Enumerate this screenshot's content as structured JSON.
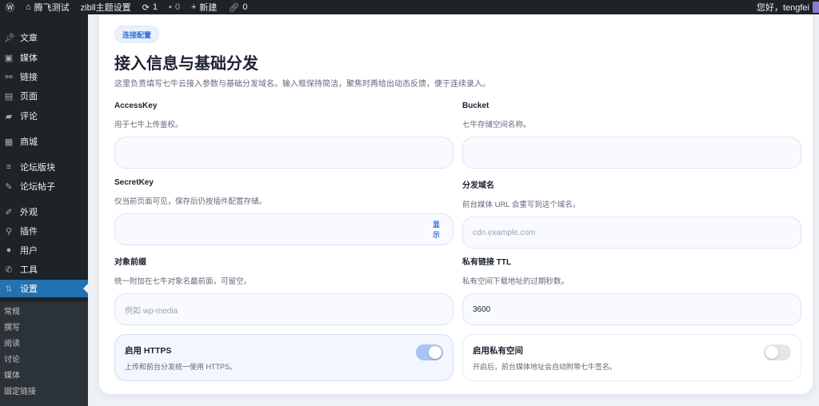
{
  "adminbar": {
    "site": "腾飞测试",
    "theme": "zibll主题设置",
    "updates": "1",
    "comments": "0",
    "new": "新建",
    "links": "0",
    "greeting": "您好，tengfei"
  },
  "sidebar": {
    "items": [
      {
        "label": "文章",
        "icon": "pin-icon"
      },
      {
        "label": "媒体",
        "icon": "media-icon"
      },
      {
        "label": "链接",
        "icon": "link-icon"
      },
      {
        "label": "页面",
        "icon": "page-icon"
      },
      {
        "label": "评论",
        "icon": "comment-icon"
      },
      {
        "label": "商城",
        "icon": "store-icon"
      },
      {
        "label": "论坛版块",
        "icon": "forum-icon"
      },
      {
        "label": "论坛帖子",
        "icon": "post-icon"
      },
      {
        "label": "外观",
        "icon": "brush-icon"
      },
      {
        "label": "插件",
        "icon": "plugin-icon"
      },
      {
        "label": "用户",
        "icon": "user-icon"
      },
      {
        "label": "工具",
        "icon": "wrench-icon"
      },
      {
        "label": "设置",
        "icon": "settings-icon"
      }
    ],
    "submenu": [
      "常规",
      "撰写",
      "阅读",
      "讨论",
      "媒体",
      "固定链接"
    ]
  },
  "card": {
    "badge": "连接配置",
    "title": "接入信息与基础分发",
    "lead": "这里负责填写七牛云接入参数与基础分发域名。输入框保持简洁，聚焦时再给出动态反馈，便于连续录入。",
    "fields": [
      {
        "label": "AccessKey",
        "hint": "用于七牛上传鉴权。",
        "value": "",
        "placeholder": ""
      },
      {
        "label": "Bucket",
        "hint": "七牛存储空间名称。",
        "value": "",
        "placeholder": ""
      },
      {
        "label": "SecretKey",
        "hint": "仅当前页面可见，保存后仍按插件配置存储。",
        "value": "",
        "placeholder": "",
        "action": "显示"
      },
      {
        "label": "分发域名",
        "hint": "前台媒体 URL 会重写到这个域名。",
        "value": "",
        "placeholder": "cdn.example.com"
      },
      {
        "label": "对象前缀",
        "hint": "统一附加在七牛对象名最前面，可留空。",
        "value": "",
        "placeholder": "例如 wp-media"
      },
      {
        "label": "私有链接 TTL",
        "hint": "私有空间下载地址的过期秒数。",
        "value": "3600",
        "placeholder": ""
      }
    ],
    "toggles": [
      {
        "title": "启用 HTTPS",
        "desc": "上传和前台分发统一使用 HTTPS。",
        "on": true
      },
      {
        "title": "启用私有空间",
        "desc": "开启后，前台媒体地址会自动附带七牛签名。",
        "on": false
      }
    ]
  }
}
